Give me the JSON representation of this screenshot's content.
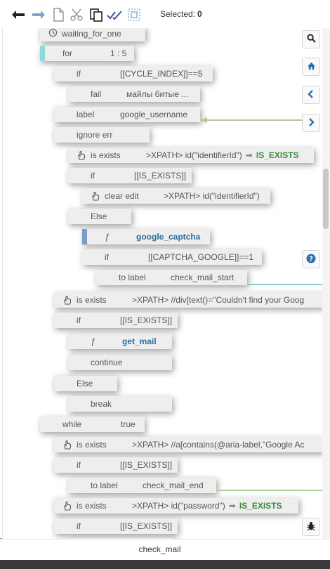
{
  "toolbar": {
    "icons": [
      "undo-icon",
      "redo-icon",
      "copy-icon",
      "cut-icon",
      "paste-icon",
      "check-icon",
      "select-icon"
    ],
    "selected_label": "Selected:",
    "selected_count": "0"
  },
  "blocks": [
    {
      "name": "block-waiting-for-one",
      "cmd": "waiting_for_one"
    },
    {
      "name": "block-for",
      "cmd": "for",
      "arg": "1 : 5"
    },
    {
      "name": "block-if-cycle-index",
      "cmd": "if",
      "arg": "[[CYCLE_INDEX]]==5"
    },
    {
      "name": "block-fail",
      "cmd": "fail",
      "arg": "майлы битые ..."
    },
    {
      "name": "block-label-google-username",
      "cmd": "label",
      "arg": "google_username"
    },
    {
      "name": "block-ignore-err",
      "cmd": "ignore err"
    },
    {
      "name": "block-is-exists-identifier",
      "cmd": "is exists",
      "arg": ">XPATH> id(\"identifierId\")",
      "result": "IS_EXISTS"
    },
    {
      "name": "block-if-is-exists-1",
      "cmd": "if",
      "arg": "[[IS_EXISTS]]"
    },
    {
      "name": "block-clear-edit",
      "cmd": "clear edit",
      "arg": ">XPATH> id(\"identifierId\")"
    },
    {
      "name": "block-else-1",
      "cmd": "Else"
    },
    {
      "name": "block-fn-google-captcha",
      "cmd": "ƒ",
      "arg": "google_captcha"
    },
    {
      "name": "block-if-captcha",
      "cmd": "if",
      "arg": "[[CAPTCHA_GOOGLE]]==1"
    },
    {
      "name": "block-to-label-check-mail-start",
      "cmd": "to label",
      "arg": "check_mail_start"
    },
    {
      "name": "block-is-exists-couldnt-find",
      "cmd": "is exists",
      "arg": ">XPATH> //div[text()=\"Couldn't find your Goog"
    },
    {
      "name": "block-if-is-exists-2",
      "cmd": "if",
      "arg": "[[IS_EXISTS]]"
    },
    {
      "name": "block-fn-get-mail",
      "cmd": "ƒ",
      "arg": "get_mail"
    },
    {
      "name": "block-continue",
      "cmd": "continue"
    },
    {
      "name": "block-else-2",
      "cmd": "Else"
    },
    {
      "name": "block-break",
      "cmd": "break"
    },
    {
      "name": "block-while",
      "cmd": "while",
      "arg": "true"
    },
    {
      "name": "block-is-exists-aria-label",
      "cmd": "is exists",
      "arg": ">XPATH> //a[contains(@aria-label,\"Google Ac"
    },
    {
      "name": "block-if-is-exists-3",
      "cmd": "if",
      "arg": "[[IS_EXISTS]]"
    },
    {
      "name": "block-to-label-check-mail-end",
      "cmd": "to label",
      "arg": "check_mail_end"
    },
    {
      "name": "block-is-exists-password",
      "cmd": "is exists",
      "arg": ">XPATH> id(\"password\")",
      "result": "IS_EXISTS"
    },
    {
      "name": "block-if-is-exists-4",
      "cmd": "if",
      "arg": "[[IS_EXISTS]]"
    }
  ],
  "side_buttons": [
    "search-icon",
    "home-icon",
    "chevron-left-icon",
    "chevron-right-icon",
    "help-icon",
    "bug-icon"
  ],
  "footer": {
    "title": "check_mail"
  },
  "colors": {
    "function": "#2a6f9e",
    "exists_result": "#3a8a3a",
    "block_bg": "#eeeeee",
    "connector_label": "#c8bf95",
    "connector_teal": "#8fc7c7",
    "connector_green": "#a8d39a"
  }
}
